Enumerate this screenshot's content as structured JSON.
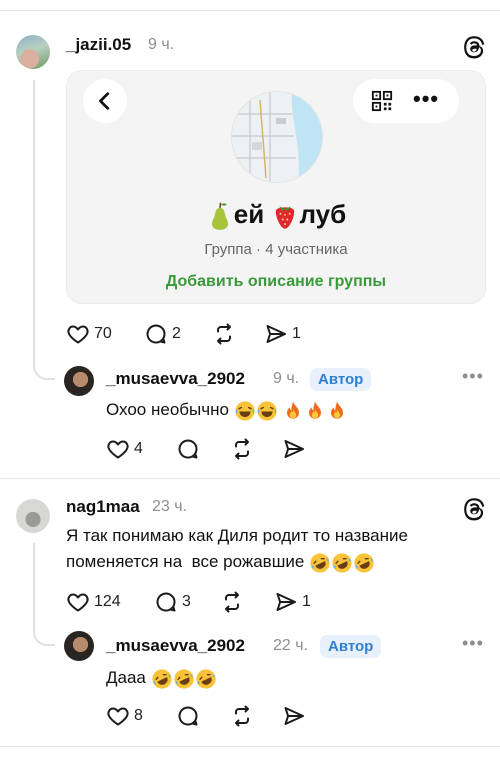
{
  "post1": {
    "username": "_jazii.05",
    "time": "9 ч.",
    "card": {
      "group_name_part1": "ей",
      "group_name_part2": "луб",
      "group_meta": "Группа · 4 участника",
      "add_description": "Добавить описание группы"
    },
    "likes": "70",
    "replies": "2",
    "shares": "1"
  },
  "reply1": {
    "username": "_musaevva_2902",
    "time": "9 ч.",
    "badge": "Автор",
    "text": "Охоо необычно",
    "likes": "4"
  },
  "post2": {
    "username": "nag1maa",
    "time": "23 ч.",
    "text_line1": "Я так понимаю как Диля родит то название",
    "text_line2": "поменяется на  все рожавшие",
    "likes": "124",
    "replies": "3",
    "shares": "1"
  },
  "reply2": {
    "username": "_musaevva_2902",
    "time": "22 ч.",
    "badge": "Автор",
    "text": "Дааа",
    "likes": "8"
  },
  "icons": {
    "like": "heart-icon",
    "reply": "comment-icon",
    "repost": "repost-icon",
    "share": "send-icon",
    "threads": "threads-logo-icon",
    "more": "more-dots-icon"
  },
  "colors": {
    "badge_bg": "#e8f1fb",
    "badge_text": "#2f7fd4",
    "add_description": "#3a9a3a",
    "muted": "#8e8e8e"
  }
}
